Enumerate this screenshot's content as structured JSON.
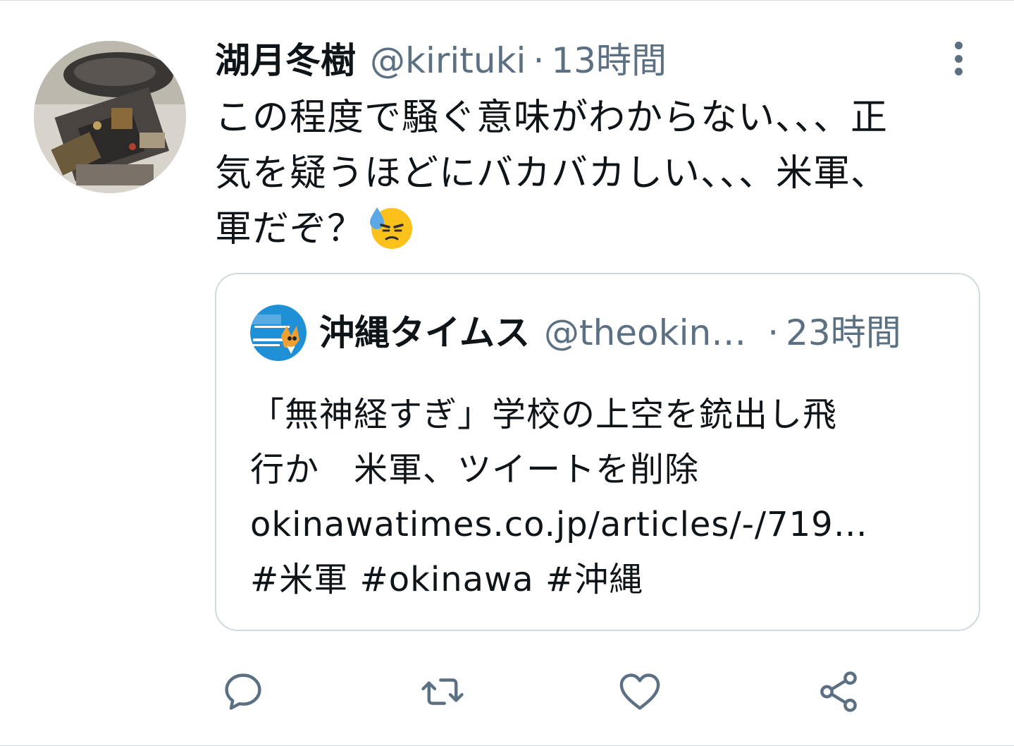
{
  "tweet": {
    "author": {
      "display_name": "湖月冬樹",
      "handle": "@kirituki",
      "avatar": "avatar-photo"
    },
    "separator": "·",
    "time": "13時間",
    "text_lines": [
      "この程度で騒ぐ意味がわからない、、、正",
      "気を疑うほどにバカバカしい、、、米軍、",
      "軍だぞ？"
    ],
    "emoji": "downcast-face-with-sweat-emoji",
    "more_icon": "more-vertical-icon"
  },
  "quoted_tweet": {
    "author": {
      "display_name": "沖縄タイムス",
      "handle": "@theokin…",
      "avatar": "okinawa-times-logo"
    },
    "separator": "·",
    "time": "23時間",
    "text_lines": [
      "「無神経すぎ」学校の上空を銃出し飛",
      "行か　米軍、ツイートを削除",
      "okinawatimes.co.jp/articles/-/719…",
      "#米軍 #okinawa #沖縄"
    ]
  },
  "actions": [
    {
      "name": "reply",
      "icon": "reply-icon"
    },
    {
      "name": "retweet",
      "icon": "retweet-icon"
    },
    {
      "name": "like",
      "icon": "heart-icon"
    },
    {
      "name": "share",
      "icon": "share-icon"
    }
  ],
  "colors": {
    "text_primary": "#0f1419",
    "text_secondary": "#5b7083",
    "border": "#cfd9de"
  }
}
